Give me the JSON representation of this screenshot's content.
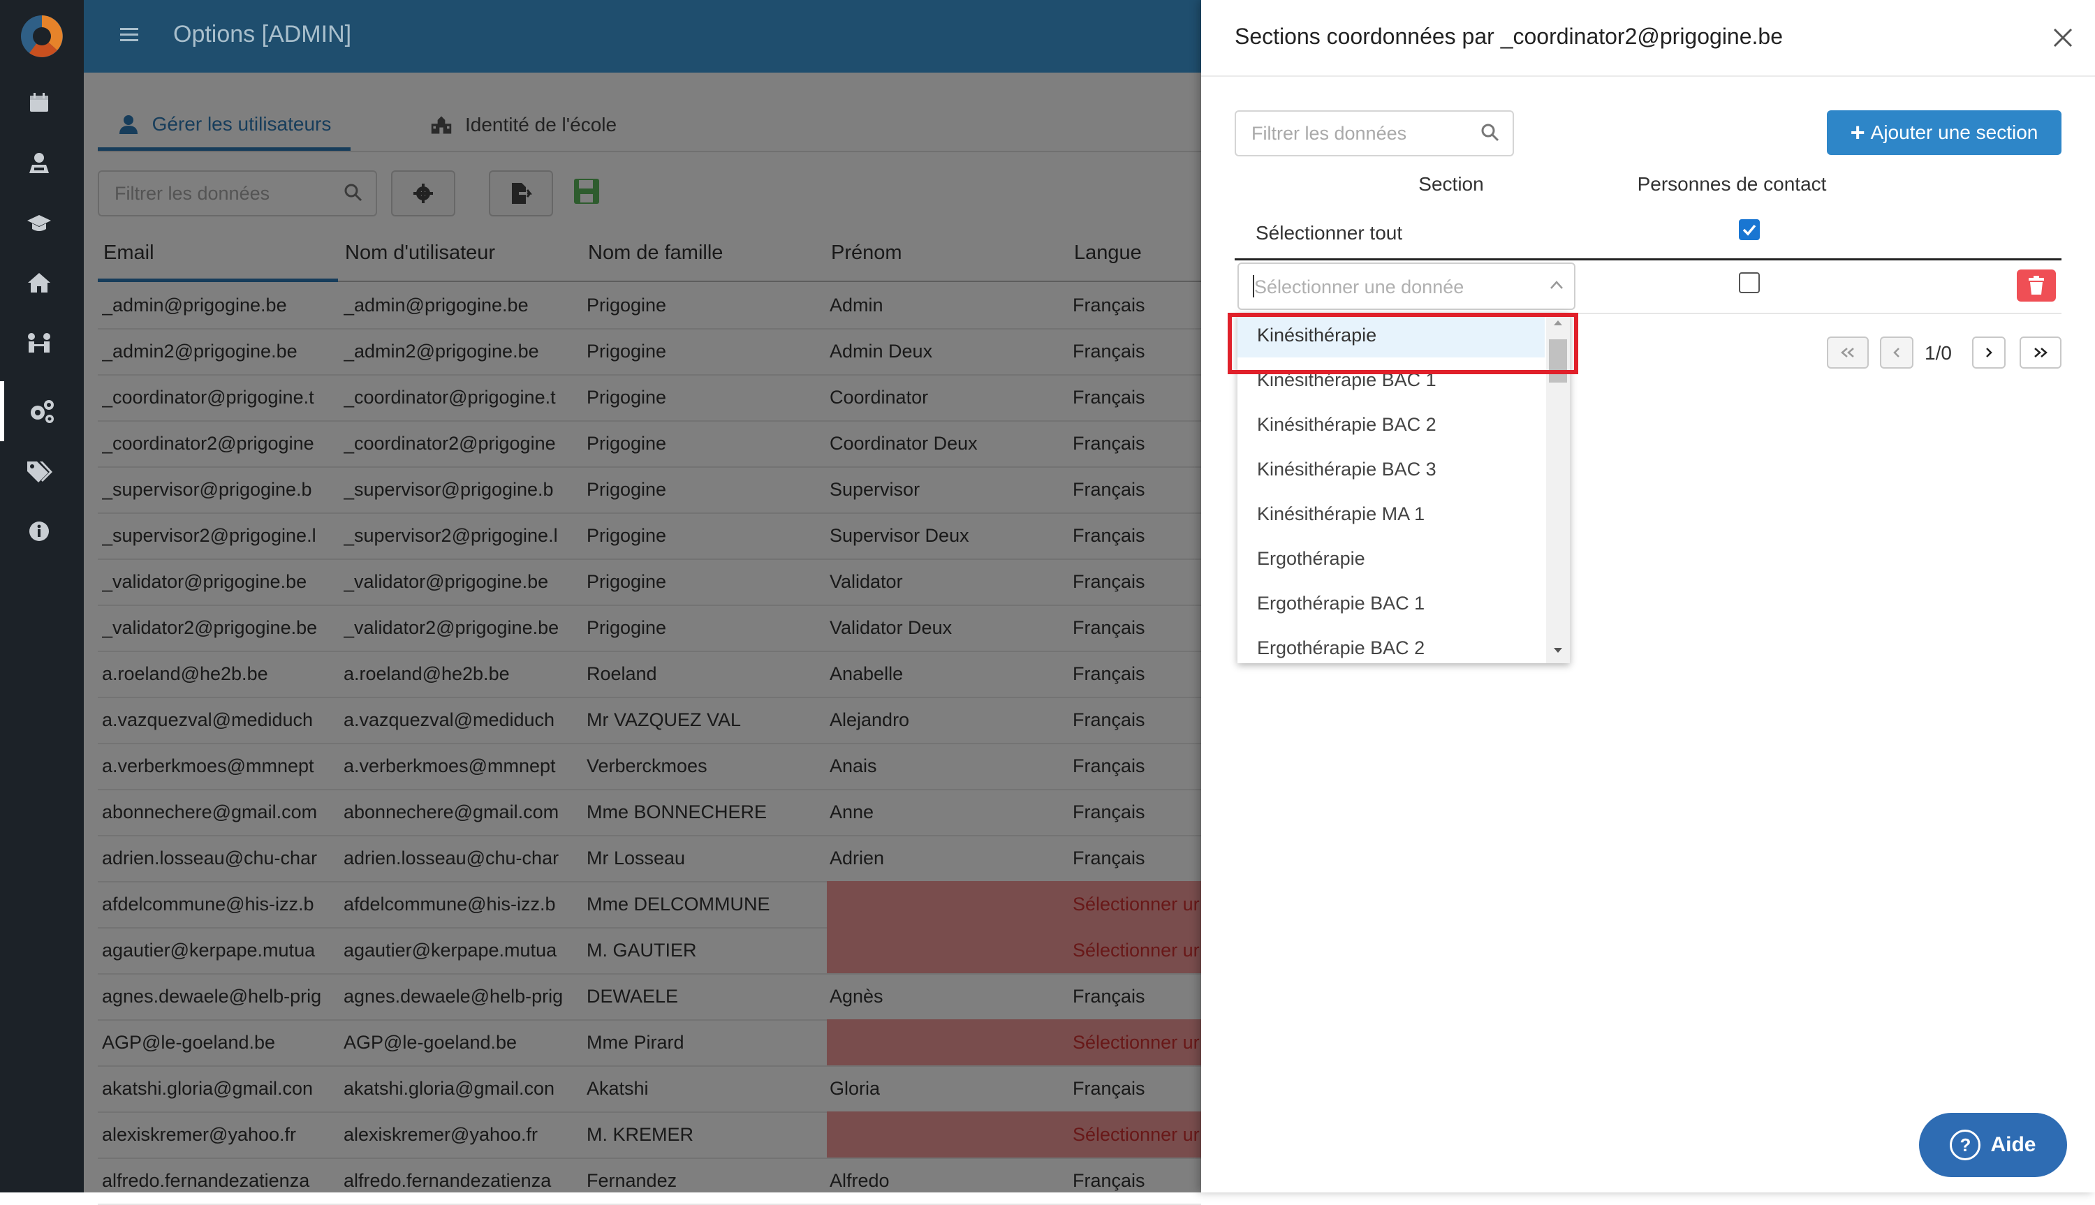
{
  "topbar": {
    "title": "Options [ADMIN]"
  },
  "tabs": [
    {
      "label": "Gérer les utilisateurs",
      "icon": "user-icon"
    },
    {
      "label": "Identité de l'école",
      "icon": "school-icon"
    }
  ],
  "toolbar": {
    "filter_placeholder": "Filtrer les données"
  },
  "grid": {
    "columns": [
      "Email",
      "Nom d'utilisateur",
      "Nom de famille",
      "Prénom",
      "Langue"
    ],
    "rows": [
      [
        "_admin@prigogine.be",
        "_admin@prigogine.be",
        "Prigogine",
        "Admin",
        "Français"
      ],
      [
        "_admin2@prigogine.be",
        "_admin2@prigogine.be",
        "Prigogine",
        "Admin Deux",
        "Français"
      ],
      [
        "_coordinator@prigogine.t",
        "_coordinator@prigogine.t",
        "Prigogine",
        "Coordinator",
        "Français"
      ],
      [
        "_coordinator2@prigogine",
        "_coordinator2@prigogine",
        "Prigogine",
        "Coordinator Deux",
        "Français"
      ],
      [
        "_supervisor@prigogine.b",
        "_supervisor@prigogine.b",
        "Prigogine",
        "Supervisor",
        "Français"
      ],
      [
        "_supervisor2@prigogine.l",
        "_supervisor2@prigogine.l",
        "Prigogine",
        "Supervisor Deux",
        "Français"
      ],
      [
        "_validator@prigogine.be",
        "_validator@prigogine.be",
        "Prigogine",
        "Validator",
        "Français"
      ],
      [
        "_validator2@prigogine.be",
        "_validator2@prigogine.be",
        "Prigogine",
        "Validator Deux",
        "Français"
      ],
      [
        "a.roeland@he2b.be",
        "a.roeland@he2b.be",
        "Roeland",
        "Anabelle",
        "Français"
      ],
      [
        "a.vazquezval@mediduch",
        "a.vazquezval@mediduch",
        "Mr VAZQUEZ VAL",
        "Alejandro",
        "Français"
      ],
      [
        "a.verberkmoes@mmnept",
        "a.verberkmoes@mmnept",
        "Verberckmoes",
        "Anais",
        "Français"
      ],
      [
        "abonnechere@gmail.com",
        "abonnechere@gmail.com",
        "Mme BONNECHERE",
        "Anne",
        "Français"
      ],
      [
        "adrien.losseau@chu-char",
        "adrien.losseau@chu-char",
        "Mr Losseau",
        "Adrien",
        "Français"
      ],
      [
        "afdelcommune@his-izz.b",
        "afdelcommune@his-izz.b",
        "Mme DELCOMMUNE",
        "",
        "Sélectionner ur"
      ],
      [
        "agautier@kerpape.mutua",
        "agautier@kerpape.mutua",
        "M. GAUTIER",
        "",
        "Sélectionner ur"
      ],
      [
        "agnes.dewaele@helb-prig",
        "agnes.dewaele@helb-prig",
        "DEWAELE",
        "Agnès",
        "Français"
      ],
      [
        "AGP@le-goeland.be",
        "AGP@le-goeland.be",
        "Mme Pirard",
        "",
        "Sélectionner ur"
      ],
      [
        "akatshi.gloria@gmail.con",
        "akatshi.gloria@gmail.con",
        "Akatshi",
        "Gloria",
        "Français"
      ],
      [
        "alexiskremer@yahoo.fr",
        "alexiskremer@yahoo.fr",
        "M. KREMER",
        "",
        "Sélectionner ur"
      ],
      [
        "alfredo.fernandezatienza",
        "alfredo.fernandezatienza",
        "Fernandez",
        "Alfredo",
        "Français"
      ]
    ]
  },
  "drawer": {
    "title": "Sections coordonnées par _coordinator2@prigogine.be",
    "filter_placeholder": "Filtrer les données",
    "add_button": "Ajouter une section",
    "col_section": "Section",
    "col_contact": "Personnes de contact",
    "select_all": "Sélectionner tout",
    "select_placeholder": "Sélectionner une donnée",
    "pager_text": "1/0",
    "dropdown_options": [
      "Kinésithérapie",
      "Kinésithérapie BAC 1",
      "Kinésithérapie BAC 2",
      "Kinésithérapie BAC 3",
      "Kinésithérapie MA 1",
      "Ergothérapie",
      "Ergothérapie BAC 1",
      "Ergothérapie BAC 2"
    ],
    "highlighted_option": "Kinésithérapie"
  },
  "help": {
    "label": "Aide"
  },
  "colors": {
    "accent": "#2e86c8",
    "topbar": "#1f4e6e",
    "sidebar": "#1c2228",
    "danger": "#ef4f55",
    "highlight": "#e0202a"
  }
}
